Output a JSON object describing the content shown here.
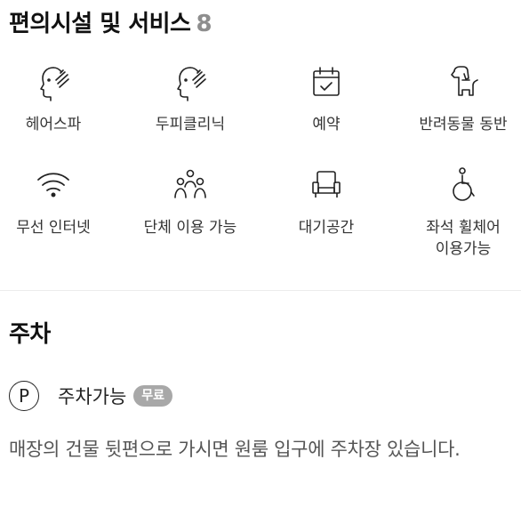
{
  "amenities": {
    "title": "편의시설 및 서비스",
    "count": "8",
    "items": [
      {
        "label": "헤어스파",
        "icon": "hair-spa-icon"
      },
      {
        "label": "두피클리닉",
        "icon": "scalp-clinic-icon"
      },
      {
        "label": "예약",
        "icon": "calendar-check-icon"
      },
      {
        "label": "반려동물 동반",
        "icon": "dog-icon"
      },
      {
        "label": "무선 인터넷",
        "icon": "wifi-icon"
      },
      {
        "label": "단체 이용 가능",
        "icon": "group-icon"
      },
      {
        "label": "대기공간",
        "icon": "armchair-icon"
      },
      {
        "label": "좌석 휠체어\n이용가능",
        "icon": "wheelchair-icon"
      }
    ]
  },
  "parking": {
    "title": "주차",
    "icon_letter": "P",
    "status": "주차가능",
    "badge": "무료",
    "description": "매장의 건물 뒷편으로 가시면 원룸 입구에 주차장 있습니다."
  }
}
